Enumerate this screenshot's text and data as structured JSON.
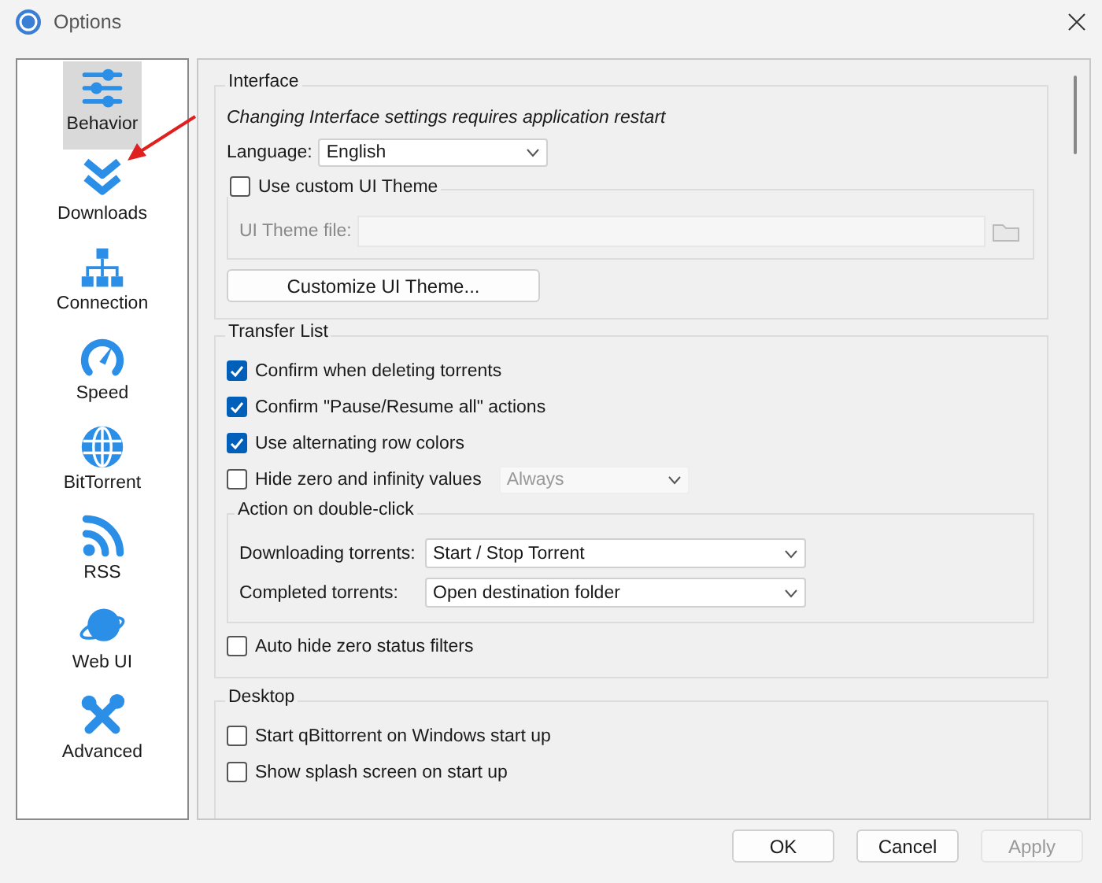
{
  "window": {
    "title": "Options"
  },
  "sidebar": {
    "items": [
      {
        "label": "Behavior",
        "selected": true
      },
      {
        "label": "Downloads",
        "selected": false
      },
      {
        "label": "Connection",
        "selected": false
      },
      {
        "label": "Speed",
        "selected": false
      },
      {
        "label": "BitTorrent",
        "selected": false
      },
      {
        "label": "RSS",
        "selected": false
      },
      {
        "label": "Web UI",
        "selected": false
      },
      {
        "label": "Advanced",
        "selected": false
      }
    ]
  },
  "interface": {
    "title": "Interface",
    "note": "Changing Interface settings requires application restart",
    "language_label": "Language:",
    "language_value": "English",
    "custom_theme": {
      "label": "Use custom UI Theme",
      "checked": false
    },
    "theme_file_label": "UI Theme file:",
    "customize_button": "Customize UI Theme..."
  },
  "transfer_list": {
    "title": "Transfer List",
    "options": [
      {
        "label": "Confirm when deleting torrents",
        "checked": true
      },
      {
        "label": "Confirm \"Pause/Resume all\" actions",
        "checked": true
      },
      {
        "label": "Use alternating row colors",
        "checked": true
      },
      {
        "label": "Hide zero and infinity values",
        "checked": false,
        "select": {
          "value": "Always",
          "disabled": true
        }
      }
    ],
    "double_click": {
      "title": "Action on double-click",
      "rows": [
        {
          "label": "Downloading torrents:",
          "value": "Start / Stop Torrent"
        },
        {
          "label": "Completed torrents:",
          "value": "Open destination folder"
        }
      ]
    },
    "auto_hide": {
      "label": "Auto hide zero status filters",
      "checked": false
    }
  },
  "desktop": {
    "title": "Desktop",
    "options": [
      {
        "label": "Start qBittorrent on Windows start up",
        "checked": false
      },
      {
        "label": "Show splash screen on start up",
        "checked": false
      }
    ]
  },
  "buttons": [
    {
      "label": "OK",
      "disabled": false
    },
    {
      "label": "Cancel",
      "disabled": false
    },
    {
      "label": "Apply",
      "disabled": true
    }
  ]
}
